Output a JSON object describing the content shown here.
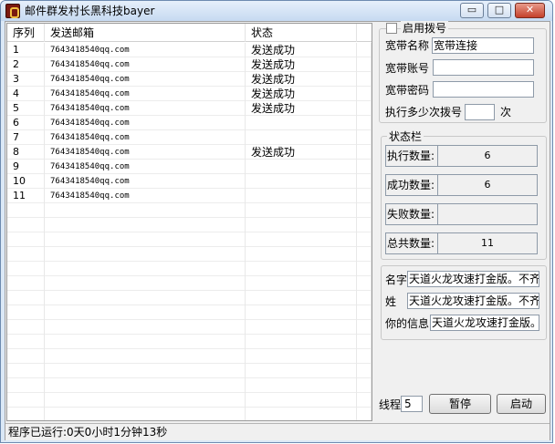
{
  "window": {
    "title": "邮件群发村长黑科技bayer",
    "min_glyph": "▭",
    "max_glyph": "□",
    "close_glyph": "✕"
  },
  "grid": {
    "headers": [
      "序列",
      "发送邮箱",
      "状态"
    ],
    "rows": [
      {
        "id": "1",
        "email": "7643418540qq.com",
        "status": "发送成功"
      },
      {
        "id": "2",
        "email": "7643418540qq.com",
        "status": "发送成功"
      },
      {
        "id": "3",
        "email": "7643418540qq.com",
        "status": "发送成功"
      },
      {
        "id": "4",
        "email": "7643418540qq.com",
        "status": "发送成功"
      },
      {
        "id": "5",
        "email": "7643418540qq.com",
        "status": "发送成功"
      },
      {
        "id": "6",
        "email": "7643418540qq.com",
        "status": ""
      },
      {
        "id": "7",
        "email": "7643418540qq.com",
        "status": ""
      },
      {
        "id": "8",
        "email": "7643418540qq.com",
        "status": "发送成功"
      },
      {
        "id": "9",
        "email": "7643418540qq.com",
        "status": ""
      },
      {
        "id": "10",
        "email": "7643418540qq.com",
        "status": ""
      },
      {
        "id": "11",
        "email": "7643418540qq.com",
        "status": ""
      }
    ]
  },
  "dial": {
    "enable_label": "启用拨号",
    "name_label": "宽带名称",
    "name_value": "宽带连接",
    "account_label": "宽带账号",
    "account_value": "",
    "password_label": "宽带密码",
    "password_value": "",
    "times_label": "执行多少次拨号",
    "times_value": "",
    "times_unit": "次"
  },
  "stats": {
    "group_label": "状态栏",
    "exec_label": "执行数量:",
    "exec_value": "6",
    "success_label": "成功数量:",
    "success_value": "6",
    "fail_label": "失败数量:",
    "fail_value": "",
    "total_label": "总共数量:",
    "total_value": "11"
  },
  "info": {
    "name_label": "名字",
    "name_value": "天道火龙攻速打金版。不齐",
    "surname_label": "姓",
    "surname_value": "天道火龙攻速打金版。不齐",
    "yourinfo_label": "你的信息",
    "yourinfo_value": "天道火龙攻速打金版。"
  },
  "controls": {
    "threads_label": "线程",
    "threads_value": "5",
    "pause_label": "暂停",
    "start_label": "启动"
  },
  "statusbar": {
    "text": "程序已运行:0天0小时1分钟13秒"
  }
}
